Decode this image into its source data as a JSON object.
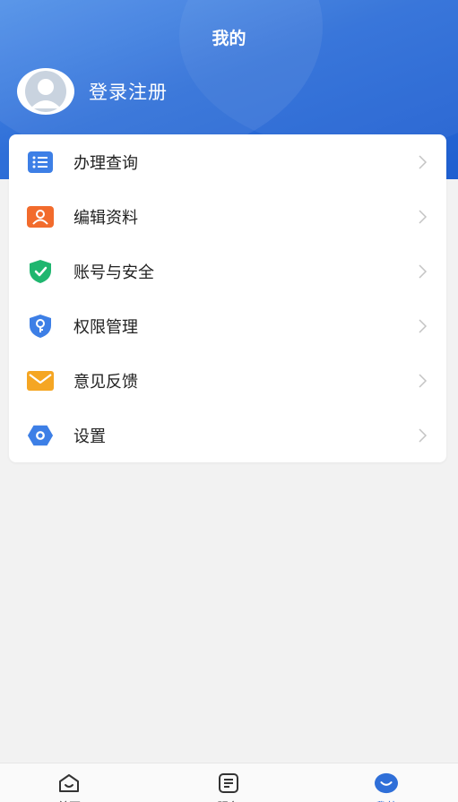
{
  "header": {
    "title": "我的",
    "profile_name": "登录注册"
  },
  "menu": {
    "items": [
      {
        "label": "办理查询",
        "icon": "list-icon",
        "color": "#3d7fe6"
      },
      {
        "label": "编辑资料",
        "icon": "profile-card-icon",
        "color": "#f26b2c"
      },
      {
        "label": "账号与安全",
        "icon": "shield-check-icon",
        "color": "#1fb66f"
      },
      {
        "label": "权限管理",
        "icon": "key-shield-icon",
        "color": "#3d7fe6"
      },
      {
        "label": "意见反馈",
        "icon": "envelope-icon",
        "color": "#f5a623"
      },
      {
        "label": "设置",
        "icon": "settings-hexagon-icon",
        "color": "#3d7fe6"
      }
    ]
  },
  "tabbar": {
    "tabs": [
      {
        "label": "首页",
        "icon": "home-icon",
        "active": false
      },
      {
        "label": "服务",
        "icon": "document-icon",
        "active": false
      },
      {
        "label": "我的",
        "icon": "smile-icon",
        "active": true
      }
    ]
  },
  "colors": {
    "accent": "#2f6fd8",
    "background": "#f2f2f2"
  }
}
